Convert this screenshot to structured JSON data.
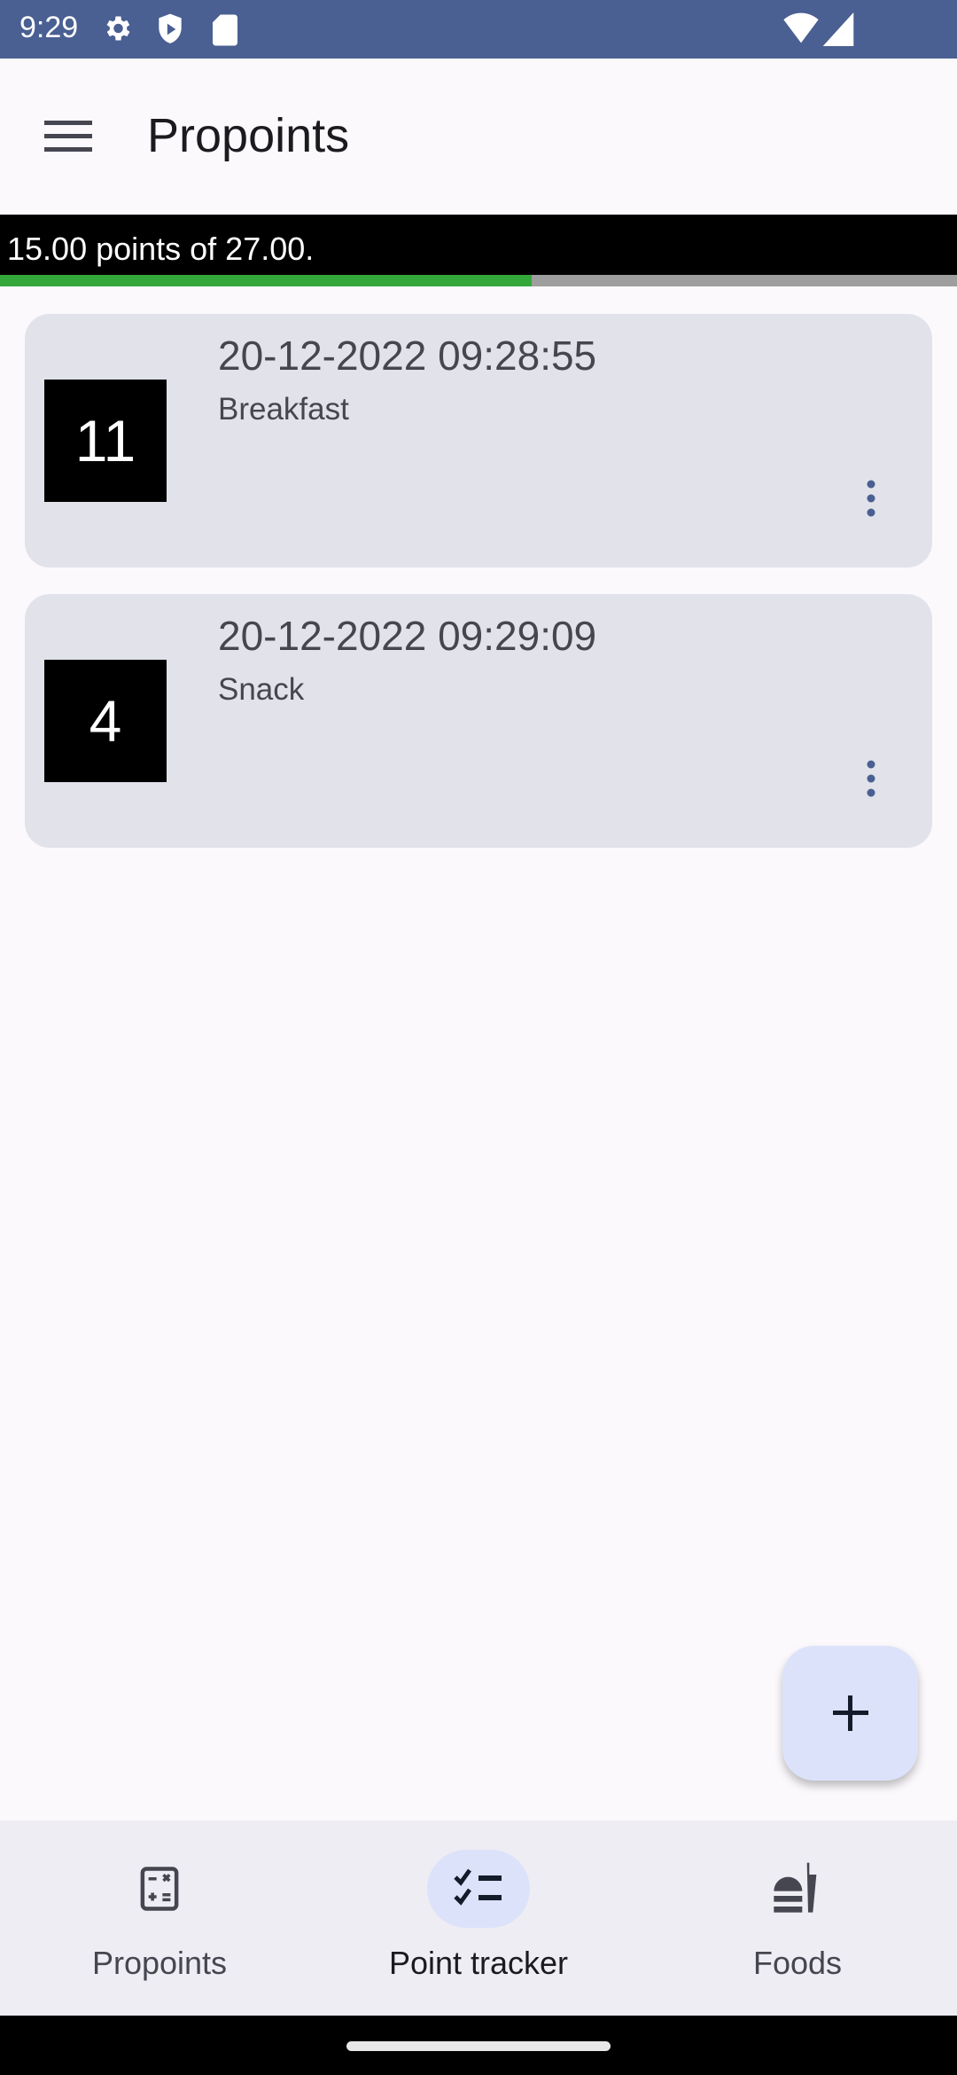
{
  "status_bar": {
    "time": "9:29",
    "icons": [
      "gear-icon",
      "shield-play-icon",
      "sd-card-icon",
      "wifi-icon",
      "signal-icon"
    ]
  },
  "app_bar": {
    "title": "Propoints",
    "menu_icon": "hamburger-icon"
  },
  "summary": {
    "text": "15.00 points of 27.00.",
    "points_used": 15,
    "points_total": 27,
    "progress_color": "#34a83a",
    "track_color": "#9e9e9e"
  },
  "entries": [
    {
      "points": "11",
      "datetime": "20-12-2022 09:28:55",
      "label": "Breakfast"
    },
    {
      "points": "4",
      "datetime": "20-12-2022 09:29:09",
      "label": "Snack"
    }
  ],
  "fab": {
    "icon": "plus-icon"
  },
  "bottom_nav": {
    "items": [
      {
        "label": "Propoints",
        "icon": "calculator-icon",
        "selected": false
      },
      {
        "label": "Point tracker",
        "icon": "checklist-icon",
        "selected": true
      },
      {
        "label": "Foods",
        "icon": "fastfood-icon",
        "selected": false
      }
    ]
  }
}
